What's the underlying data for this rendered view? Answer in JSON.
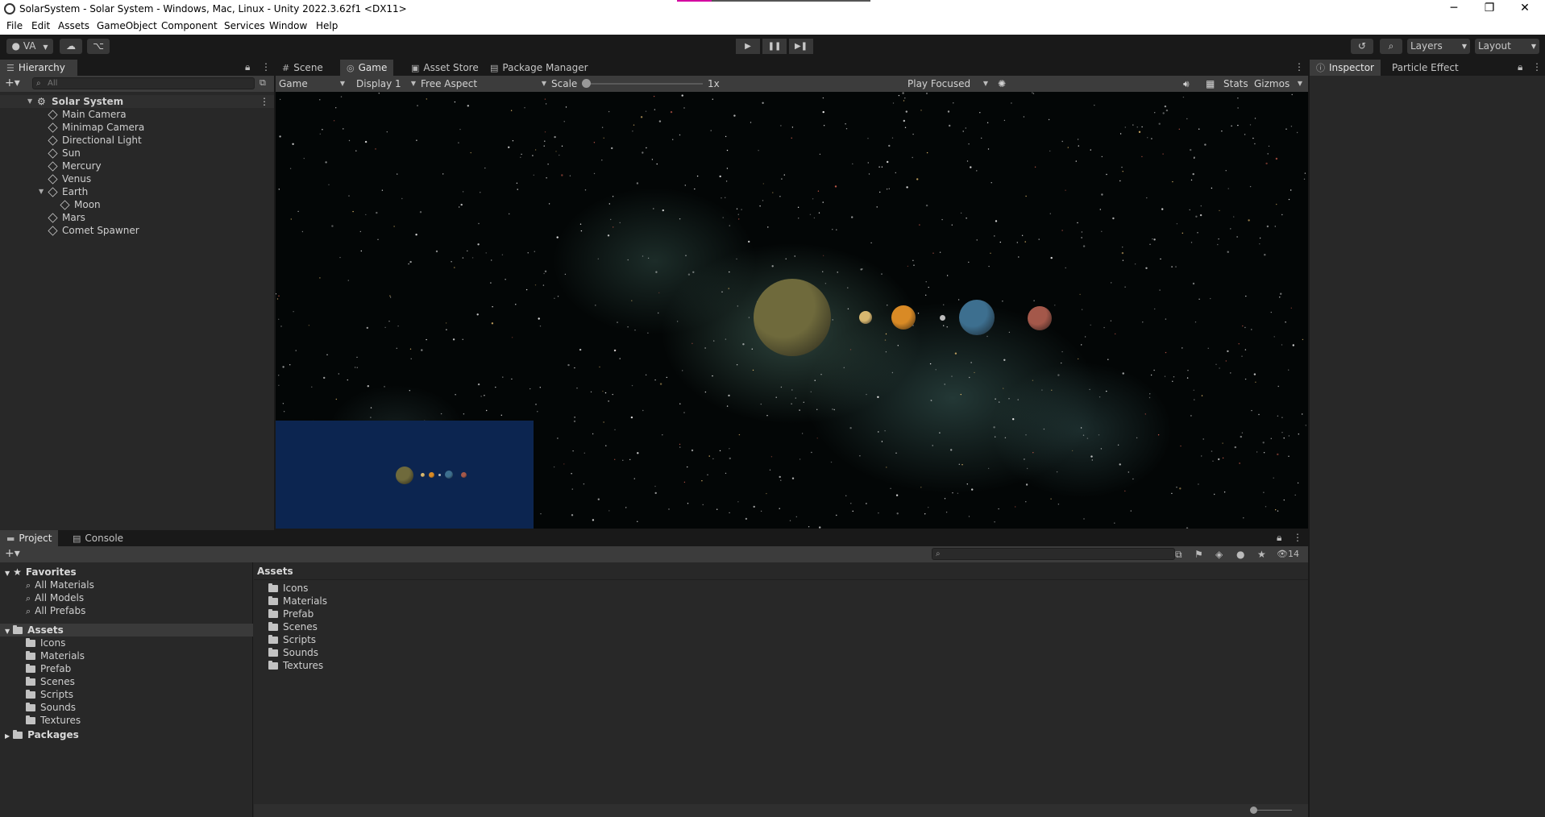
{
  "window": {
    "title": "SolarSystem - Solar System - Windows, Mac, Linux - Unity 2022.3.62f1 <DX11>",
    "minimize": "─",
    "restore": "❐",
    "close": "✕",
    "load_progress": 0.18
  },
  "menu": [
    "File",
    "Edit",
    "Assets",
    "GameObject",
    "Component",
    "Services",
    "Window",
    "Help"
  ],
  "toolbar": {
    "account": "VA",
    "layers": "Layers",
    "layout": "Layout"
  },
  "hierarchy": {
    "tab": "Hierarchy",
    "search_placeholder": "All",
    "scene_root": "Solar System",
    "items": [
      "Main Camera",
      "Minimap Camera",
      "Directional Light",
      "Sun",
      "Mercury",
      "Venus",
      "Earth",
      "Moon",
      "Mars",
      "Comet Spawner"
    ]
  },
  "center_tabs": [
    "Scene",
    "Game",
    "Asset Store",
    "Package Manager"
  ],
  "game_toolbar": {
    "mode": "Game",
    "display": "Display 1",
    "aspect": "Free Aspect",
    "scale_label": "Scale",
    "scale_value": "1x",
    "play_focused": "Play Focused",
    "stats": "Stats",
    "gizmos": "Gizmos"
  },
  "inspector_tabs": [
    "Inspector",
    "Particle Effect"
  ],
  "project": {
    "tabs": [
      "Project",
      "Console"
    ],
    "favorites_label": "Favorites",
    "favorites": [
      "All Materials",
      "All Models",
      "All Prefabs"
    ],
    "assets_label": "Assets",
    "asset_folders": [
      "Icons",
      "Materials",
      "Prefab",
      "Scenes",
      "Scripts",
      "Sounds",
      "Textures"
    ],
    "packages_label": "Packages",
    "breadcrumb": "Assets",
    "hidden_count": "14"
  },
  "colors": {
    "sun": "#6f6a3c",
    "mercury": "#d9b870",
    "venus": "#d98a25",
    "earth": "#3d6f8f",
    "mars": "#a4584a",
    "minimap_bg": "#0c2550"
  }
}
